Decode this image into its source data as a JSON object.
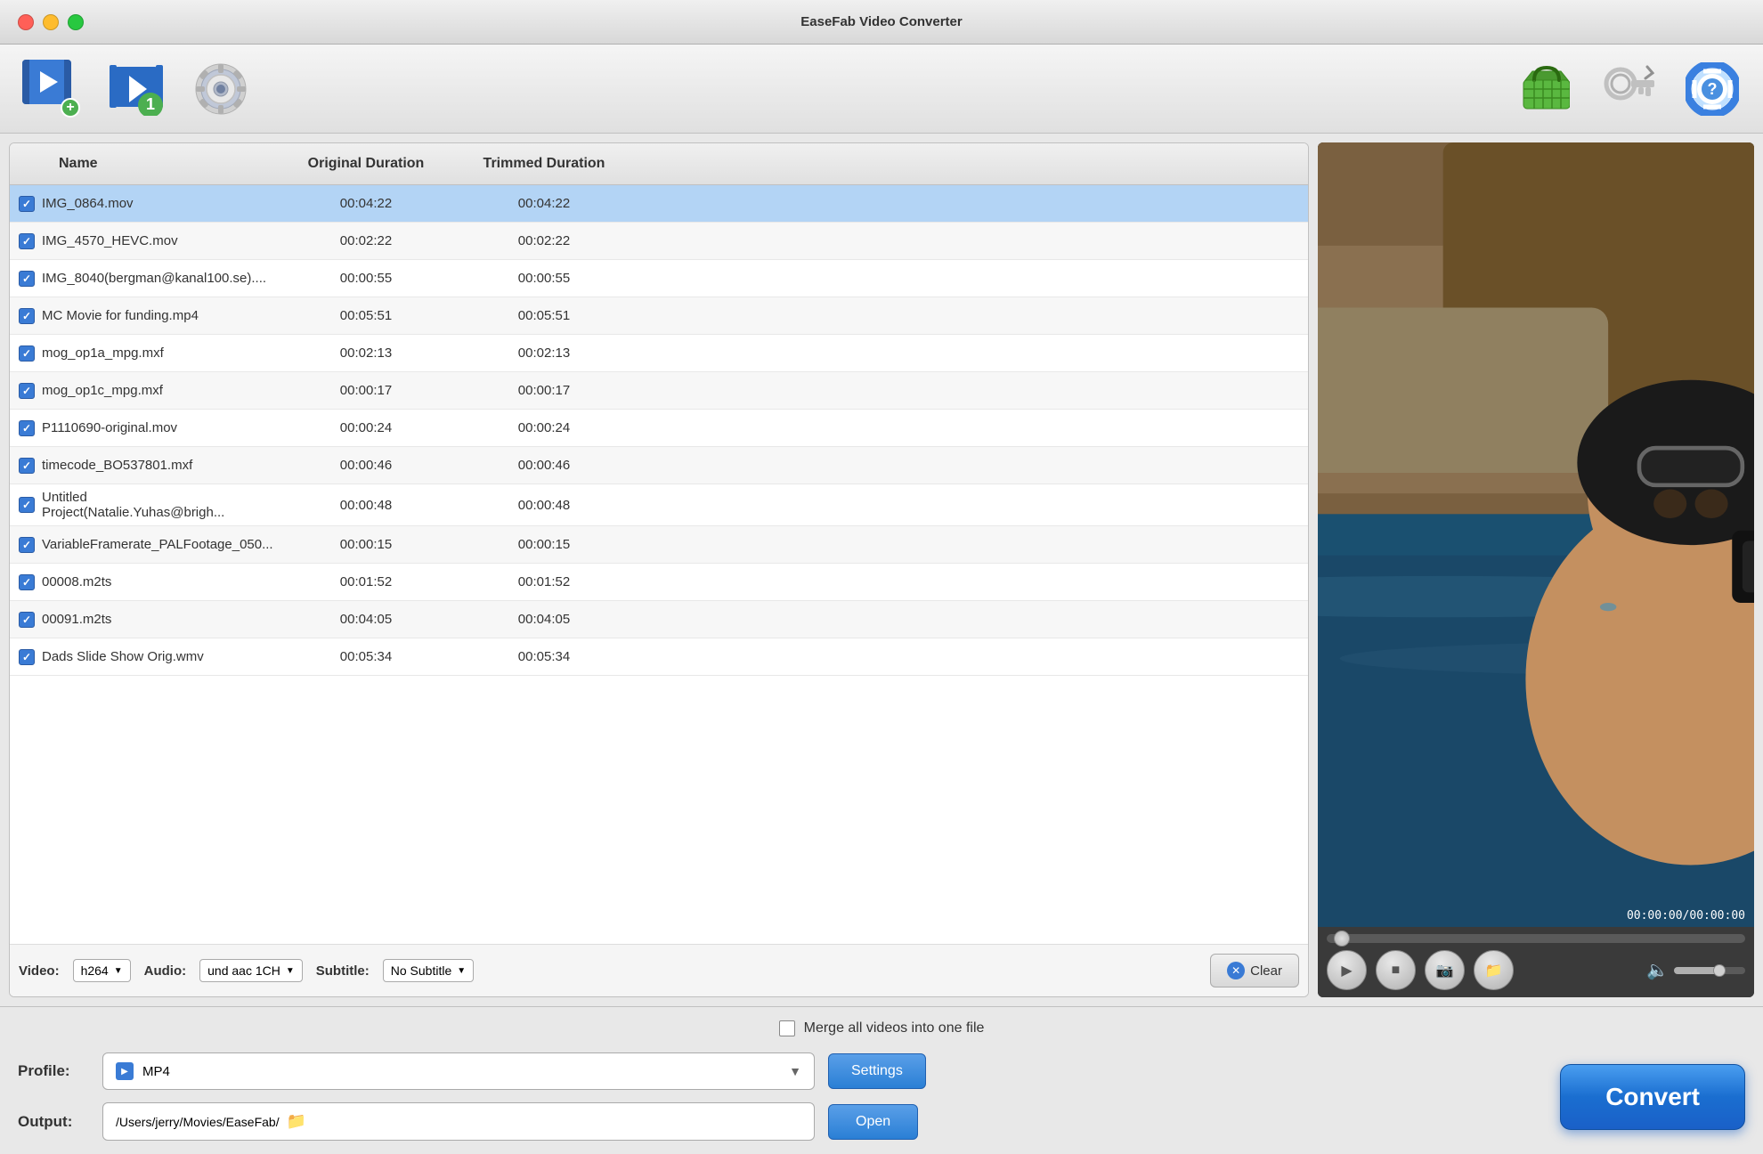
{
  "window": {
    "title": "EaseFab Video Converter"
  },
  "toolbar": {
    "add_video_tooltip": "Add Video",
    "add_file_tooltip": "Add File",
    "settings_tooltip": "Settings",
    "basket_tooltip": "Buy",
    "key_tooltip": "Register",
    "help_tooltip": "Help"
  },
  "table": {
    "columns": [
      "Name",
      "Original Duration",
      "Trimmed Duration"
    ],
    "rows": [
      {
        "name": "IMG_0864.mov",
        "original": "00:04:22",
        "trimmed": "00:04:22",
        "checked": true,
        "selected": true
      },
      {
        "name": "IMG_4570_HEVC.mov",
        "original": "00:02:22",
        "trimmed": "00:02:22",
        "checked": true,
        "selected": false
      },
      {
        "name": "IMG_8040(bergman@kanal100.se)....",
        "original": "00:00:55",
        "trimmed": "00:00:55",
        "checked": true,
        "selected": false
      },
      {
        "name": "MC Movie for funding.mp4",
        "original": "00:05:51",
        "trimmed": "00:05:51",
        "checked": true,
        "selected": false
      },
      {
        "name": "mog_op1a_mpg.mxf",
        "original": "00:02:13",
        "trimmed": "00:02:13",
        "checked": true,
        "selected": false
      },
      {
        "name": "mog_op1c_mpg.mxf",
        "original": "00:00:17",
        "trimmed": "00:00:17",
        "checked": true,
        "selected": false
      },
      {
        "name": "P1110690-original.mov",
        "original": "00:00:24",
        "trimmed": "00:00:24",
        "checked": true,
        "selected": false
      },
      {
        "name": "timecode_BO537801.mxf",
        "original": "00:00:46",
        "trimmed": "00:00:46",
        "checked": true,
        "selected": false
      },
      {
        "name": "Untitled Project(Natalie.Yuhas@brigh...",
        "original": "00:00:48",
        "trimmed": "00:00:48",
        "checked": true,
        "selected": false
      },
      {
        "name": "VariableFramerate_PALFootage_050...",
        "original": "00:00:15",
        "trimmed": "00:00:15",
        "checked": true,
        "selected": false
      },
      {
        "name": "00008.m2ts",
        "original": "00:01:52",
        "trimmed": "00:01:52",
        "checked": true,
        "selected": false
      },
      {
        "name": "00091.m2ts",
        "original": "00:04:05",
        "trimmed": "00:04:05",
        "checked": true,
        "selected": false
      },
      {
        "name": "Dads Slide Show Orig.wmv",
        "original": "00:05:34",
        "trimmed": "00:05:34",
        "checked": true,
        "selected": false
      }
    ]
  },
  "format_bar": {
    "video_label": "Video:",
    "video_value": "h264",
    "audio_label": "Audio:",
    "audio_value": "und aac 1CH",
    "subtitle_label": "Subtitle:",
    "subtitle_value": "No Subtitle",
    "clear_label": "Clear"
  },
  "video_player": {
    "timecode": "00:00:00/00:00:00"
  },
  "bottom": {
    "merge_label": "Merge all videos into one file",
    "profile_label": "Profile:",
    "profile_value": "MP4",
    "settings_label": "Settings",
    "output_label": "Output:",
    "output_path": "/Users/jerry/Movies/EaseFab/",
    "open_label": "Open",
    "convert_label": "Convert"
  }
}
